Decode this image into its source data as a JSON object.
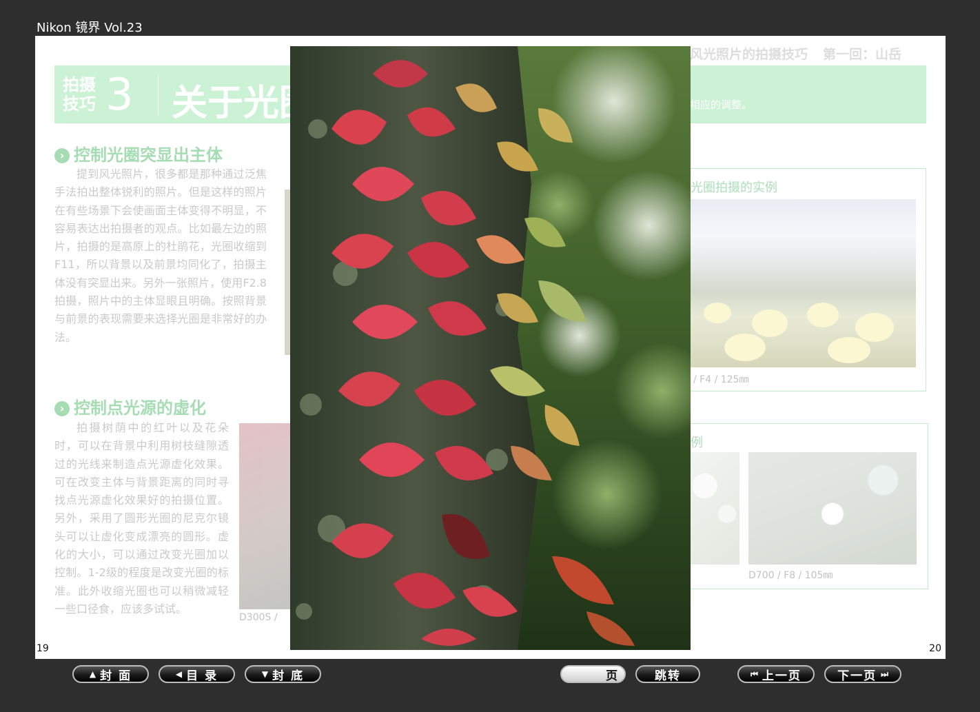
{
  "app": {
    "title": "Nikon 镜界 Vol.23"
  },
  "pages": {
    "left_number": "19",
    "right_number": "20"
  },
  "left_page": {
    "banner": {
      "tag": "拍摄\n技巧",
      "number": "3",
      "title": "关于光圈"
    },
    "section1": {
      "heading": "控制光圈突显出主体",
      "body": "提到风光照片，很多都是那种通过泛焦手法拍出整体锐利的照片。但是这样的照片在有些场景下会使画面主体变得不明显，不容易表达出拍摄者的观点。比如最左边的照片，拍摄的是高原上的杜鹃花，光圈收缩到F11，所以背景以及前景均同化了，拍摄主体没有突显出来。另外一张照片，使用F2.8拍摄，照片中的主体显眼且明确。按照背景与前景的表现需要来选择光圈是非常好的办法。"
    },
    "section2": {
      "heading": "控制点光源的虚化",
      "body": "拍摄树荫中的红叶以及花朵时，可以在背景中利用树枝缝隙透过的光线来制造点光源虚化效果。可在改变主体与背景距离的同时寻找点光源虚化效果好的拍摄位置。另外，采用了圆形光圈的尼克尔镜头可以让虚化变成漂亮的圆形。虚化的大小，可以通过改变光圈加以控制。1-2级的程度是改变光圈的标准。此外收缩光圈也可以稍微减轻一些口径食，应该多试试。"
    },
    "caption": "D300S /"
  },
  "right_page": {
    "header": {
      "title": "风光照片的拍摄技巧",
      "episode": "第一回：山岳"
    },
    "banner_note": "相应的调整。",
    "box1": {
      "title": "光圈拍摄的实例",
      "caption": "/ F4 / 125㎜"
    },
    "box2": {
      "title": "例",
      "caption": "D700 / F8 / 105㎜"
    }
  },
  "nav": {
    "cover": "封 面",
    "toc": "目 录",
    "back_cover": "封 底",
    "page_suffix": "页",
    "jump": "跳转",
    "prev": "上一页",
    "next": "下一页"
  },
  "icons": {
    "cover": "triangle-up-icon",
    "toc": "triangle-left-icon",
    "back_cover": "triangle-down-icon",
    "prev": "skip-back-icon",
    "next": "skip-forward-icon"
  },
  "colors": {
    "accent_green": "#39b25a",
    "banner_green": "#8fe3a3",
    "background": "#2e2e2e"
  }
}
